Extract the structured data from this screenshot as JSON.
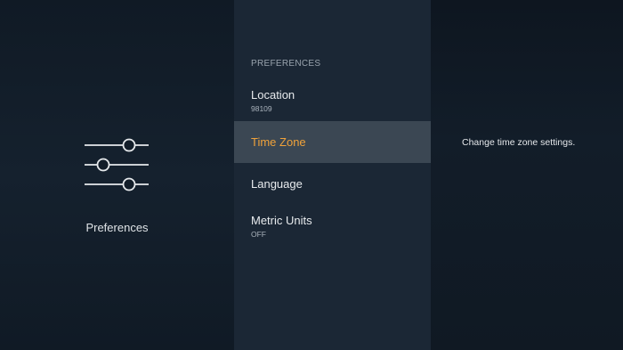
{
  "category": {
    "icon": "sliders-icon",
    "title": "Preferences"
  },
  "menu": {
    "section_header": "PREFERENCES",
    "items": [
      {
        "label": "Location",
        "value": "98109",
        "selected": false
      },
      {
        "label": "Time Zone",
        "value": "",
        "selected": true
      },
      {
        "label": "Language",
        "value": "",
        "selected": false
      },
      {
        "label": "Metric Units",
        "value": "OFF",
        "selected": false
      }
    ]
  },
  "help": {
    "text": "Change time zone settings."
  },
  "colors": {
    "accent_selected": "#f0a23a",
    "selected_row_bg": "#3b4753",
    "middle_pane_bg": "#1b2735"
  }
}
